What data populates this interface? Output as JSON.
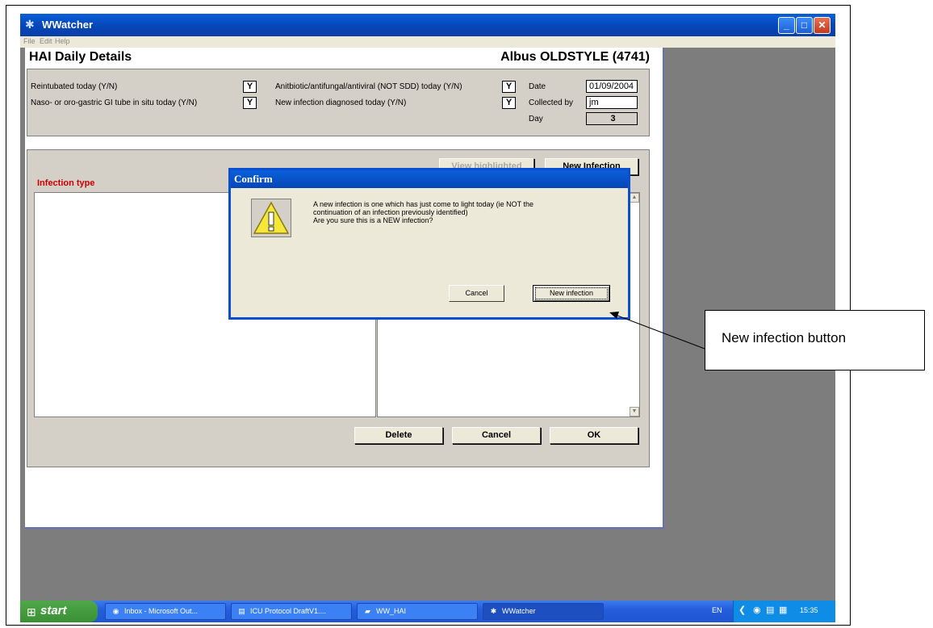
{
  "window": {
    "title": "WWatcher",
    "icon": "wwatcher-app-icon",
    "controls": [
      "minimize",
      "maximize",
      "close"
    ]
  },
  "menu": [
    "File",
    "Edit",
    "Help"
  ],
  "heading": "HAI Daily Details",
  "patient": "Albus OLDSTYLE (4741)",
  "form": {
    "reintubated_label": "Reintubated today (Y/N)",
    "reintubated_value": "Y",
    "naso_label": "Naso- or oro-gastric GI tube in situ today (Y/N)",
    "naso_value": "Y",
    "antibiotic_label": "Anitbiotic/antifungal/antiviral (NOT SDD) today (Y/N)",
    "antibiotic_value": "Y",
    "newinf_label": "New infection diagnosed today (Y/N)",
    "newinf_value": "Y",
    "date_label": "Date",
    "date_value": "01/09/2004",
    "collected_label": "Collected by",
    "collected_value": "jm",
    "day_label": "Day",
    "day_value": "3"
  },
  "infections": {
    "type_label": "Infection type",
    "view_button": "View highlighted",
    "new_button": "New Infection"
  },
  "bottom_buttons": {
    "delete": "Delete",
    "cancel": "Cancel",
    "ok": "OK"
  },
  "dialog": {
    "title": "Confirm",
    "icon": "warning-icon",
    "line1": "A new infection is one which has just come to light today (ie NOT the",
    "line2": "continuation of an infection previously identified)",
    "line3": "Are you sure this is a NEW infection?",
    "cancel": "Cancel",
    "confirm": "New infection"
  },
  "callout": "New infection button",
  "taskbar": {
    "start": "start",
    "tasks": [
      {
        "label": "Inbox - Microsoft Out...",
        "icon": "outlook-icon"
      },
      {
        "label": "ICU Protocol DraftV1....",
        "icon": "word-icon"
      },
      {
        "label": "WW_HAI",
        "icon": "folder-icon"
      },
      {
        "label": "WWatcher",
        "icon": "wwatcher-app-icon"
      }
    ],
    "lang": "EN",
    "time": "15:35"
  }
}
